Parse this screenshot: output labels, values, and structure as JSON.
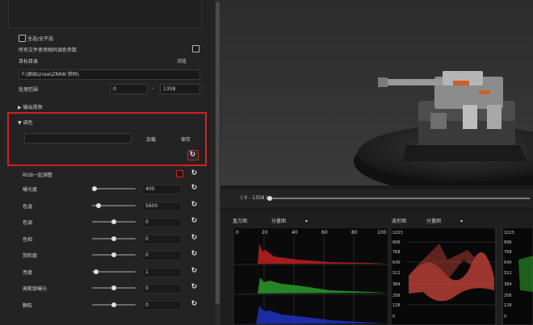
{
  "options": {
    "select_all_label": "全选/全不选",
    "same_color_params_label": "所有文件使用相同调色参数",
    "target_dir_label": "目标目录",
    "browse_label": "浏览",
    "target_dir_value": "F:\\原始\\zraw\\ZRAW 转码\\",
    "process_range_label": "处理范围",
    "range_start": "0",
    "range_sep": "-",
    "range_end": "1358",
    "output_video_label": "输出视频"
  },
  "color_section": {
    "title": "调色",
    "preset_value": "",
    "load_label": "加载",
    "save_label": "保存"
  },
  "adjust": {
    "rgb_label": "RGB一起调整",
    "rows": [
      {
        "label": "曝光度",
        "value": "400",
        "level": 0.0
      },
      {
        "label": "色温",
        "value": "5600",
        "level": 0.1
      },
      {
        "label": "色调",
        "value": "0",
        "level": 0.5
      },
      {
        "label": "色相",
        "value": "0",
        "level": 0.5
      },
      {
        "label": "饱和度",
        "value": "0",
        "level": 0.5
      },
      {
        "label": "亮度",
        "value": "1",
        "level": 0.05
      },
      {
        "label": "高斯级曝光",
        "value": "0",
        "level": 0.5
      },
      {
        "label": "颗粒",
        "value": "0",
        "level": 0.5
      }
    ]
  },
  "timeline": {
    "range_label": "( 0 - 1358 )"
  },
  "histogram": {
    "title": "直方图",
    "mode": "分量图",
    "ticks": [
      "0",
      "20",
      "40",
      "60",
      "80",
      "100"
    ]
  },
  "waveform": {
    "title": "波形图",
    "mode": "分量图",
    "ticks": [
      "1023",
      "896",
      "768",
      "640",
      "512",
      "384",
      "256",
      "128",
      "0"
    ]
  },
  "colors": {
    "accent_red": "#d42020",
    "hist_red": "#c0201e",
    "hist_green": "#2c9a2c",
    "hist_blue": "#1f2fb6"
  }
}
